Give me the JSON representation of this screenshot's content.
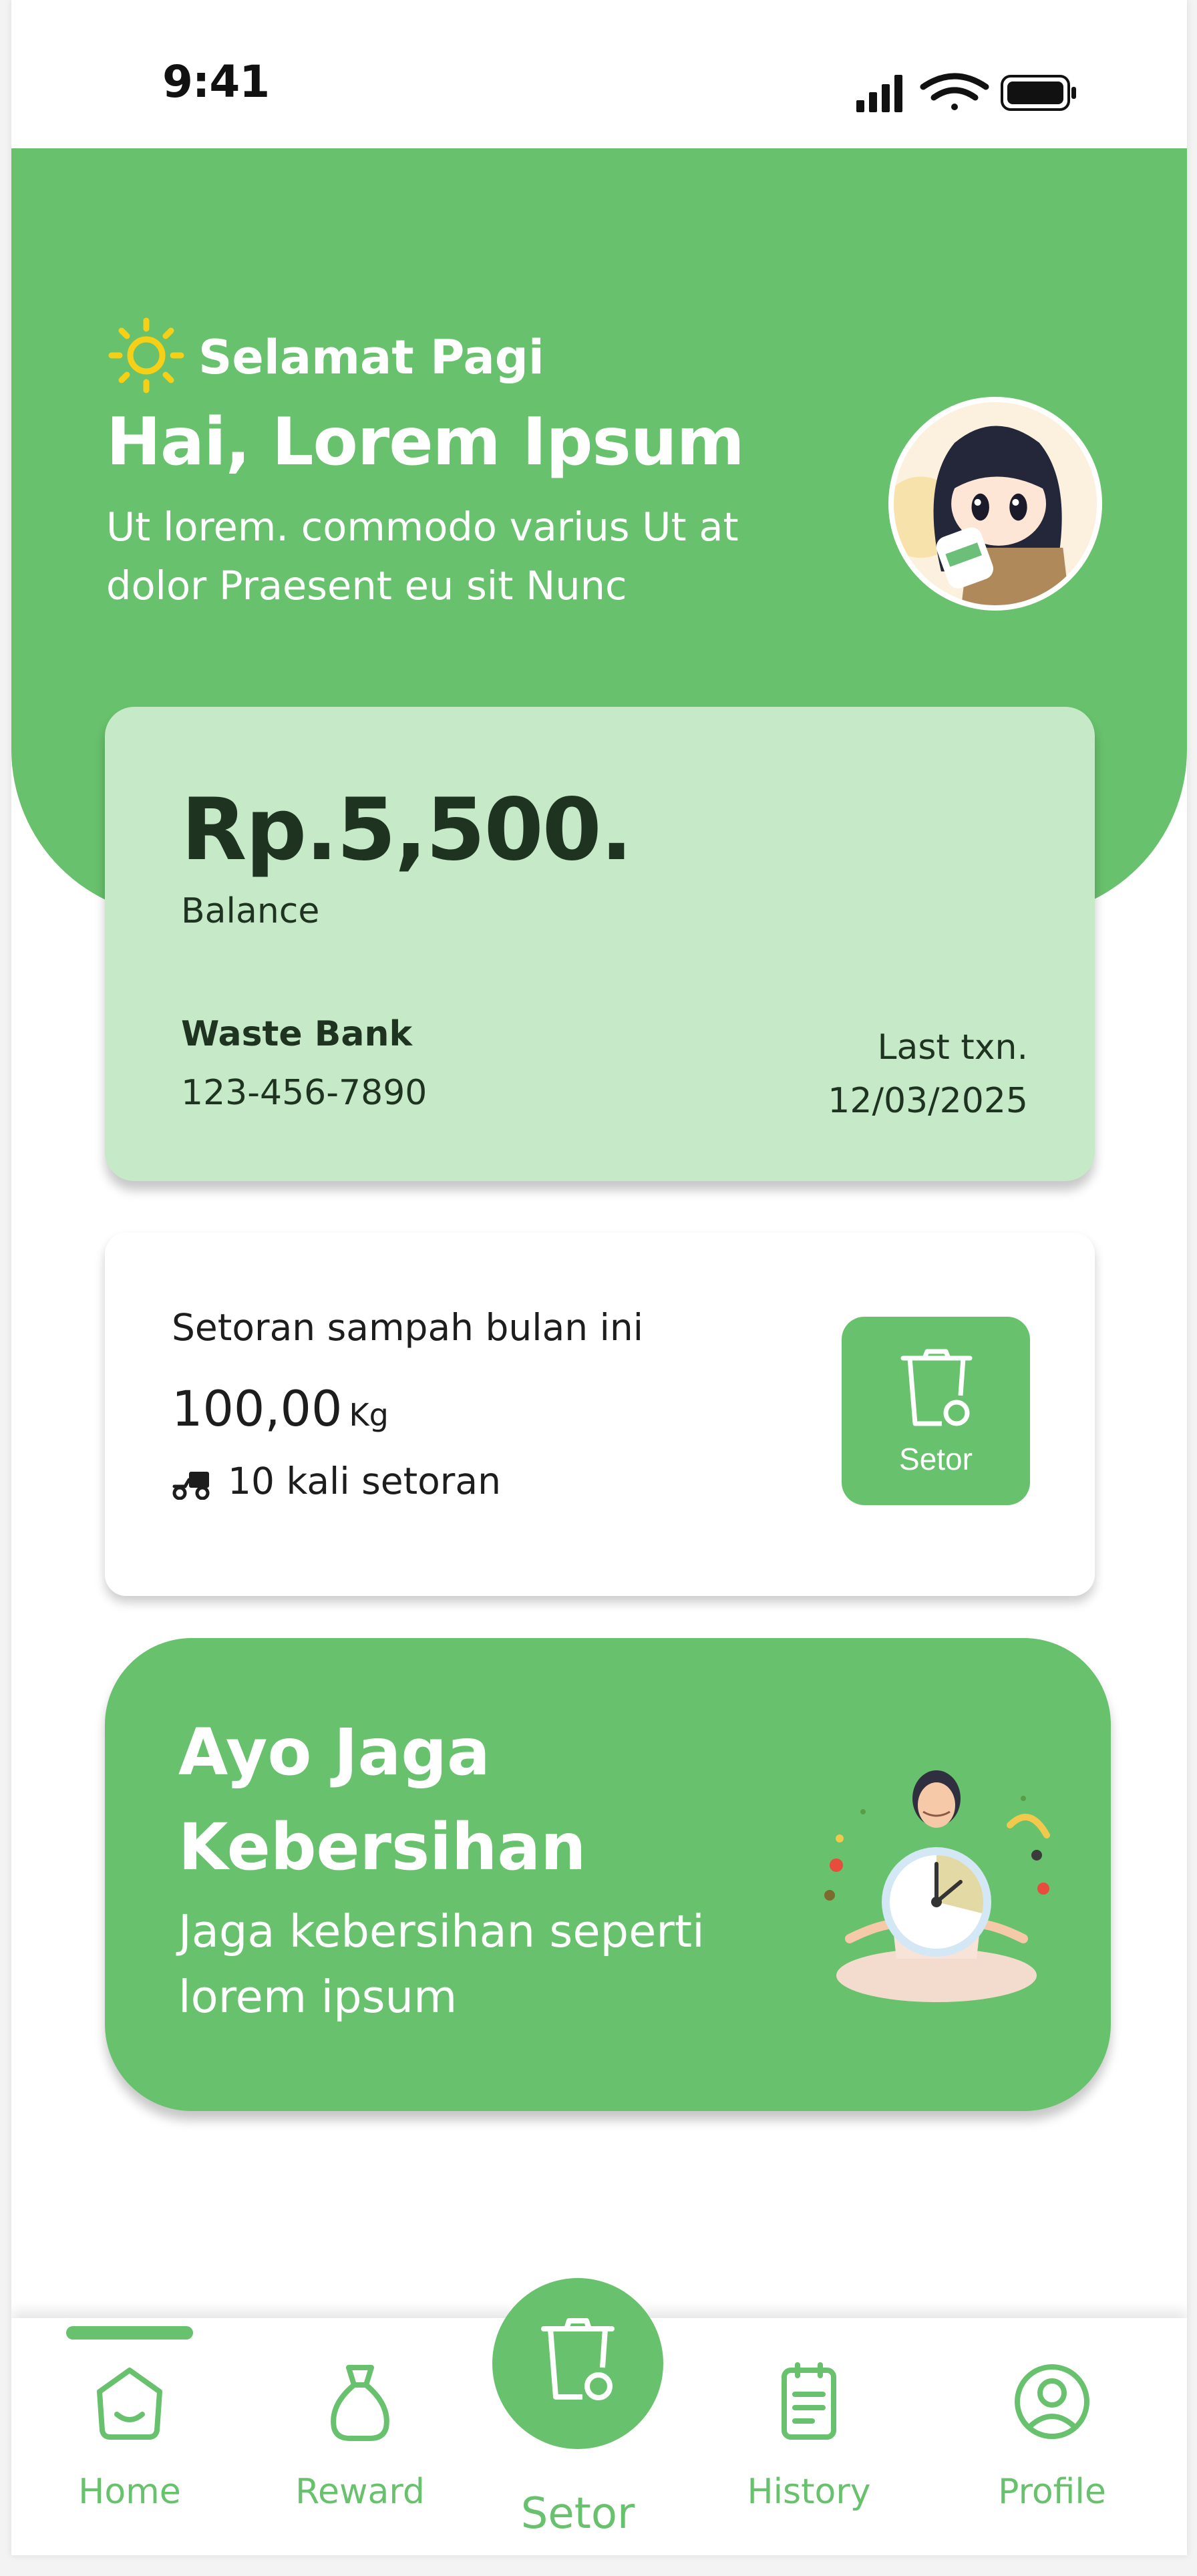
{
  "status_bar": {
    "time": "9:41"
  },
  "greeting": {
    "salutation": "Selamat Pagi",
    "name_line": "Hai, Lorem Ipsum",
    "subtitle": "Ut lorem. commodo varius Ut at dolor Praesent eu sit Nunc"
  },
  "balance": {
    "amount": "Rp.5,500.",
    "label": "Balance",
    "bank_name": "Waste Bank",
    "account_number": "123-456-7890",
    "last_txn_label": "Last txn.",
    "last_txn_date": "12/03/2025"
  },
  "deposit": {
    "title": "Setoran sampah bulan ini",
    "weight": "100,00",
    "unit": "Kg",
    "count_text": "10 kali setoran",
    "button_label": "Setor"
  },
  "promo": {
    "title": "Ayo Jaga Kebersihan",
    "subtitle": "Jaga kebersihan seperti lorem ipsum"
  },
  "nav": {
    "home": "Home",
    "reward": "Reward",
    "setor": "Setor",
    "history": "History",
    "profile": "Profile",
    "active": "home"
  },
  "colors": {
    "primary": "#68c16c",
    "card_light": "#c6eac8",
    "text_dark": "#1f3321",
    "sun": "#f5d016"
  },
  "icons": [
    "sun-icon",
    "trash-bin-icon",
    "delivery-scooter-icon",
    "home-icon",
    "money-bag-icon",
    "clipboard-list-icon",
    "user-circle-icon"
  ]
}
